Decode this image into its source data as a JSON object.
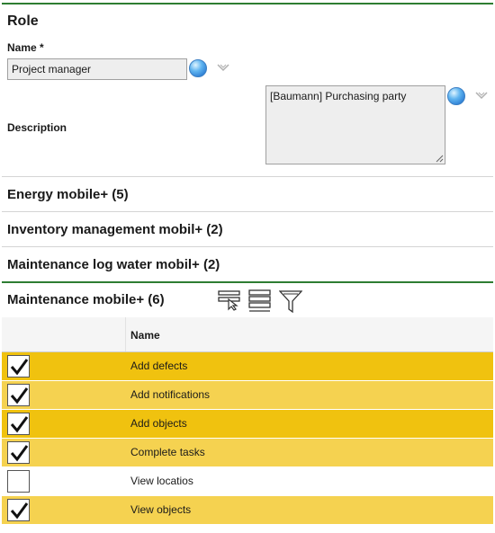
{
  "role": {
    "title": "Role",
    "name_label": "Name *",
    "name_value": "Project manager",
    "description_label": "Description",
    "description_value": "[Baumann] Purchasing party"
  },
  "sections": [
    {
      "label": "Energy mobile+ (5)"
    },
    {
      "label": "Inventory management mobil+ (2)"
    },
    {
      "label": "Maintenance log water mobil+ (2)"
    },
    {
      "label": "Maintenance mobile+ (6)"
    }
  ],
  "table": {
    "column_name": "Name",
    "rows": [
      {
        "label": "Add defects",
        "checked": true,
        "color": "#f0c20f"
      },
      {
        "label": "Add notifications",
        "checked": true,
        "color": "#f5d250"
      },
      {
        "label": "Add objects",
        "checked": true,
        "color": "#f0c20f"
      },
      {
        "label": "Complete tasks",
        "checked": true,
        "color": "#f5d250"
      },
      {
        "label": "View locatios",
        "checked": false,
        "color": "#ffffff"
      },
      {
        "label": "View objects",
        "checked": true,
        "color": "#f5d250"
      }
    ]
  },
  "icons": {
    "translate": "globe-icon",
    "dropdown": "chevron-down-icon",
    "select_rows": "select-rows-icon",
    "list": "list-icon",
    "filter": "filter-icon"
  }
}
